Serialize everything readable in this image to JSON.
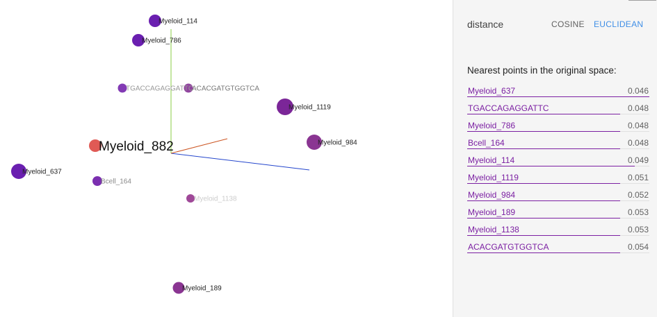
{
  "viewport": {
    "points": [
      {
        "label": "Myeloid_114",
        "color": "#6a1fb0"
      },
      {
        "label": "Myeloid_786",
        "color": "#6a1fb0"
      },
      {
        "label": "TGACCAGAGGATTC",
        "color": "#7b2fb0"
      },
      {
        "label": "ACACGATGTGGTCA",
        "color": "#8b3a9a"
      },
      {
        "label": "Myeloid_1119",
        "color": "#7b2698"
      },
      {
        "label": "Myeloid_882",
        "color": "#e05a55"
      },
      {
        "label": "Myeloid_984",
        "color": "#8a3592"
      },
      {
        "label": "Myeloid_637",
        "color": "#6a1fb0"
      },
      {
        "label": "Bcell_164",
        "color": "#7b2fb0"
      },
      {
        "label": "Myeloid_1138",
        "color": "#9a3e92"
      },
      {
        "label": "Myeloid_189",
        "color": "#8a3592"
      }
    ],
    "axis_colors": {
      "x": "#2244cc",
      "y": "#88cc44",
      "z": "#cc5522"
    }
  },
  "panel": {
    "distance_label": "distance",
    "cosine_label": "COSINE",
    "euclidean_label": "EUCLIDEAN",
    "active_metric_color": "#3f8ee6",
    "nearest_title": "Nearest points in the original space:",
    "neighbors": [
      {
        "name": "Myeloid_637",
        "value": "0.046",
        "fraction": 1.0
      },
      {
        "name": "TGACCAGAGGATTC",
        "value": "0.048",
        "fraction": 0.84
      },
      {
        "name": "Myeloid_786",
        "value": "0.048",
        "fraction": 0.84
      },
      {
        "name": "Bcell_164",
        "value": "0.048",
        "fraction": 0.84
      },
      {
        "name": "Myeloid_114",
        "value": "0.049",
        "fraction": 0.92
      },
      {
        "name": "Myeloid_1119",
        "value": "0.051",
        "fraction": 0.84
      },
      {
        "name": "Myeloid_984",
        "value": "0.052",
        "fraction": 0.84
      },
      {
        "name": "Myeloid_189",
        "value": "0.053",
        "fraction": 0.84
      },
      {
        "name": "Myeloid_1138",
        "value": "0.053",
        "fraction": 0.84
      },
      {
        "name": "ACACGATGTGGTCA",
        "value": "0.054",
        "fraction": 0.84
      }
    ]
  }
}
